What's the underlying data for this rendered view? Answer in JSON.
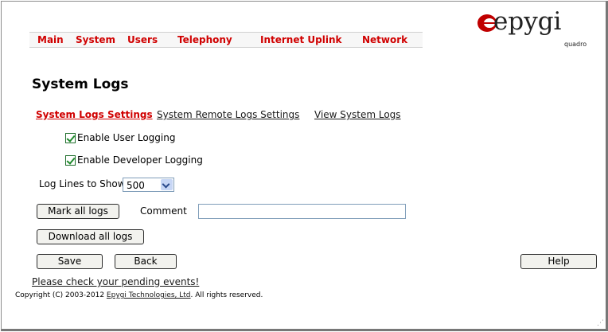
{
  "nav": {
    "items": [
      "Main",
      "System",
      "Users",
      "Telephony",
      "Internet Uplink",
      "Network"
    ]
  },
  "logo": {
    "word": "epygi",
    "sub": "quadro"
  },
  "page": {
    "title": "System Logs"
  },
  "tabs": [
    {
      "label": "System Logs Settings",
      "active": true
    },
    {
      "label": "System Remote Logs Settings",
      "active": false
    },
    {
      "label": "View System Logs",
      "active": false
    }
  ],
  "settings": {
    "user_logging": {
      "label": "Enable User Logging",
      "checked": true
    },
    "developer_logging": {
      "label": "Enable Developer Logging",
      "checked": true
    },
    "log_lines": {
      "label": "Log Lines to Show",
      "value": "500"
    }
  },
  "actions": {
    "mark_all": "Mark all logs",
    "comment_label": "Comment",
    "comment_value": "",
    "download_all": "Download all logs",
    "save": "Save",
    "back": "Back",
    "help": "Help"
  },
  "footer": {
    "pending_events": "Please check your pending events!",
    "copyright_prefix": "Copyright (C) 2003-2012 ",
    "copyright_link": "Epygi Technologies, Ltd",
    "copyright_suffix": ". All rights reserved."
  },
  "colors": {
    "accent": "#d00000",
    "checkbox": "#1f8a2c"
  }
}
